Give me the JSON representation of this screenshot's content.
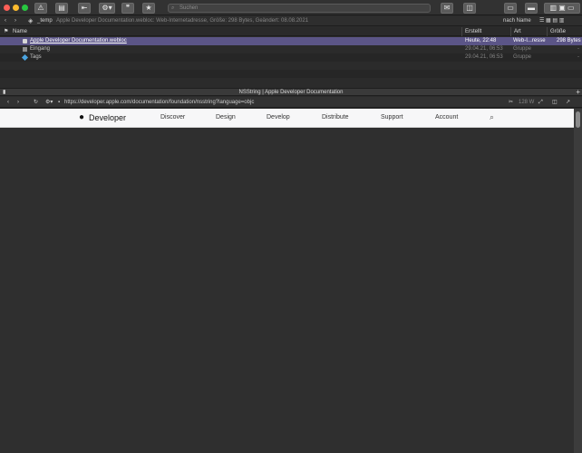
{
  "window": {
    "search_placeholder": "Suchen"
  },
  "pathbar": {
    "folder": "_temp",
    "info": "Apple Developer Documentation.webloc: Web-Internetadresse, Größe: 298 Bytes, Geändert: 08.08.2021",
    "sort": "nach Name"
  },
  "list": {
    "columns": {
      "name": "Name",
      "created": "Erstellt",
      "kind": "Art",
      "size": "Größe"
    },
    "rows": [
      {
        "name": "Apple Developer Documentation.webloc",
        "created": "Heute, 22:48",
        "kind": "Web-I...resse",
        "size": "298 Bytes"
      },
      {
        "name": "Eingang",
        "created": "29.04.21, 06:53",
        "kind": "Gruppe",
        "size": "-"
      },
      {
        "name": "Tags",
        "created": "29.04.21, 06:53",
        "kind": "Gruppe",
        "size": "-"
      }
    ]
  },
  "split": {
    "title": "NSString | Apple Developer Documentation"
  },
  "browser": {
    "url": "https://developer.apple.com/documentation/foundation/nsstring?language=objc",
    "word_count": "128 W"
  },
  "web": {
    "brand": "Developer",
    "nav": [
      "Discover",
      "Design",
      "Develop",
      "Distribute",
      "Support",
      "Account"
    ]
  },
  "colors": {
    "selection": "#5b5587",
    "traffic_red": "#ff5f57",
    "traffic_yellow": "#febc2e",
    "traffic_green": "#28c840"
  }
}
